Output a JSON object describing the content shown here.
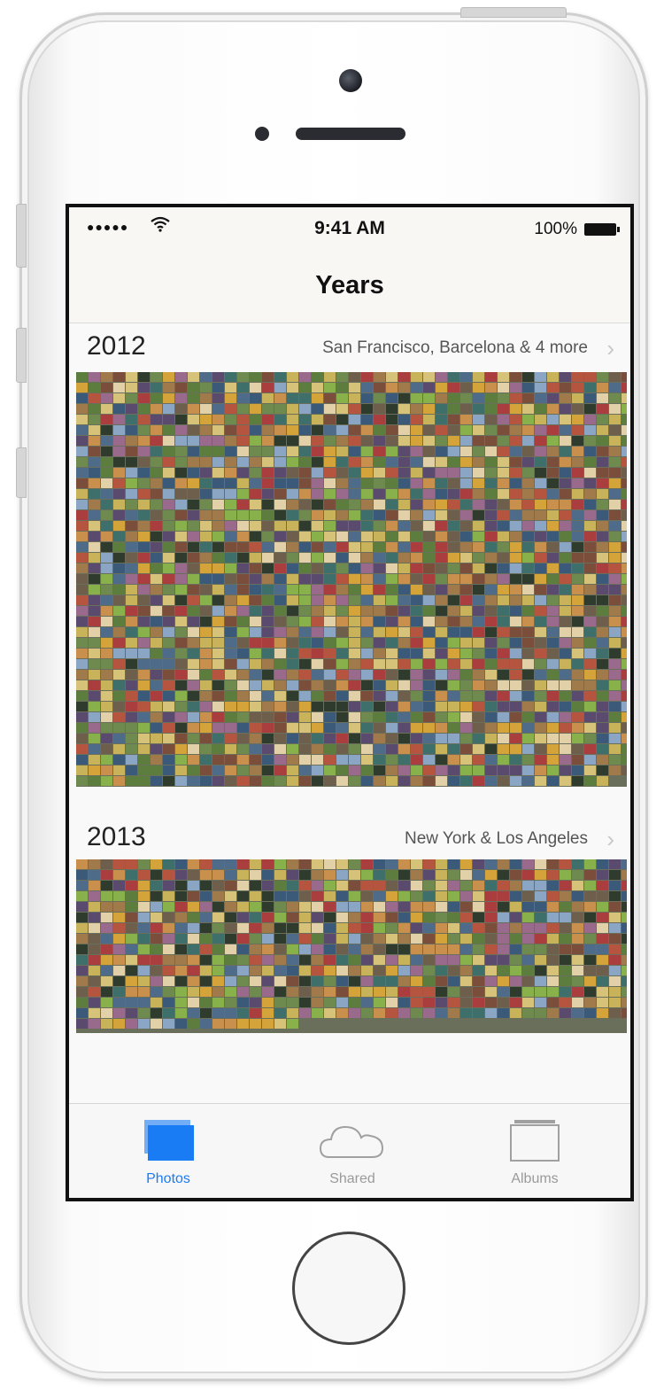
{
  "status_bar": {
    "signal": "●●●●●",
    "time": "9:41 AM",
    "battery_percent": "100%"
  },
  "nav": {
    "title": "Years"
  },
  "sections": [
    {
      "year": "2012",
      "places": "San Francisco, Barcelona & 4 more"
    },
    {
      "year": "2013",
      "places": "New York & Los Angeles"
    }
  ],
  "tabs": [
    {
      "label": "Photos",
      "icon": "photos-stack-icon",
      "active": true
    },
    {
      "label": "Shared",
      "icon": "cloud-icon",
      "active": false
    },
    {
      "label": "Albums",
      "icon": "album-icon",
      "active": false
    }
  ],
  "colors": {
    "accent": "#1a7cf5",
    "tab_inactive": "#9a9a9a"
  }
}
